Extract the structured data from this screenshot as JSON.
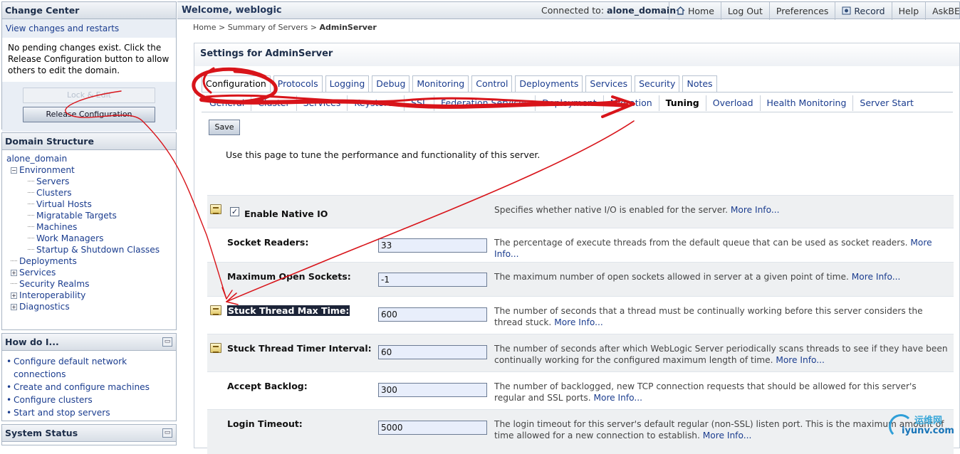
{
  "change_center": {
    "title": "Change Center",
    "view_link": "View changes and restarts",
    "message": "No pending changes exist. Click the Release Configuration button to allow others to edit the domain.",
    "lock_button": "Lock & Edit",
    "release_button": "Release Configuration"
  },
  "domain_structure": {
    "title": "Domain Structure",
    "root": "alone_domain",
    "environment": "Environment",
    "env_children": [
      "Servers",
      "Clusters",
      "Virtual Hosts",
      "Migratable Targets",
      "Machines",
      "Work Managers",
      "Startup & Shutdown Classes"
    ],
    "deployments": "Deployments",
    "services": "Services",
    "security_realms": "Security Realms",
    "interoperability": "Interoperability",
    "diagnostics": "Diagnostics",
    "expand_symbol": "+",
    "collapse_symbol": "−"
  },
  "how_do_i": {
    "title": "How do I...",
    "items": [
      "Configure default network connections",
      "Create and configure machines",
      "Configure clusters",
      "Start and stop servers"
    ]
  },
  "system_status": {
    "title": "System Status"
  },
  "topbar": {
    "welcome": "Welcome, weblogic",
    "connected_label": "Connected to:",
    "connected_domain": "alone_domain",
    "links": {
      "home": "Home",
      "logout": "Log Out",
      "preferences": "Preferences",
      "record": "Record",
      "help": "Help",
      "askbea": "AskBEA"
    }
  },
  "breadcrumb": {
    "home": "Home",
    "sep": ">",
    "summary": "Summary of Servers",
    "current": "AdminServer"
  },
  "settings": {
    "title": "Settings for AdminServer",
    "tabs": [
      "Configuration",
      "Protocols",
      "Logging",
      "Debug",
      "Monitoring",
      "Control",
      "Deployments",
      "Services",
      "Security",
      "Notes"
    ],
    "active_tab": "Configuration",
    "subtabs": [
      "General",
      "Cluster",
      "Services",
      "Keystores",
      "SSL",
      "Federation Services",
      "Deployment",
      "Migration",
      "Tuning",
      "Overload",
      "Health Monitoring",
      "Server Start"
    ],
    "active_subtab": "Tuning",
    "save": "Save",
    "intro": "Use this page to tune the performance and functionality of this server."
  },
  "fields": {
    "native_io": {
      "label": "Enable Native IO",
      "checked": true,
      "check_mark": "✓",
      "desc": "Specifies whether native I/O is enabled for the server.",
      "more": "More Info..."
    },
    "socket_readers": {
      "label": "Socket Readers:",
      "value": "33",
      "desc": "The percentage of execute threads from the default queue that can be used as socket readers.",
      "more": "More Info..."
    },
    "max_open_sockets": {
      "label": "Maximum Open Sockets:",
      "value": "-1",
      "desc": "The maximum number of open sockets allowed in server at a given point of time.",
      "more": "More Info..."
    },
    "stuck_thread_max": {
      "label": "Stuck Thread Max Time:",
      "value": "600",
      "desc": "The number of seconds that a thread must be continually working before this server considers the thread stuck.",
      "more": "More Info..."
    },
    "stuck_thread_timer": {
      "label": "Stuck Thread Timer Interval:",
      "value": "60",
      "desc": "The number of seconds after which WebLogic Server periodically scans threads to see if they have been continually working for the configured maximum length of time.",
      "more": "More Info..."
    },
    "accept_backlog": {
      "label": "Accept Backlog:",
      "value": "300",
      "desc": "The number of backlogged, new TCP connection requests that should be allowed for this server's regular and SSL ports.",
      "more": "More Info..."
    },
    "login_timeout": {
      "label": "Login Timeout:",
      "value": "5000",
      "desc": "The login timeout for this server's default regular (non-SSL) listen port. This is the maximum amount of time allowed for a new connection to establish.",
      "more": "More Info..."
    }
  },
  "watermark": {
    "cn": "运维网",
    "en": "iyunv.com"
  },
  "colors": {
    "annotation": "#d8141a",
    "link": "#1b3d8f",
    "input_bg": "#e8eefb",
    "header_text": "#1d2e4a"
  }
}
